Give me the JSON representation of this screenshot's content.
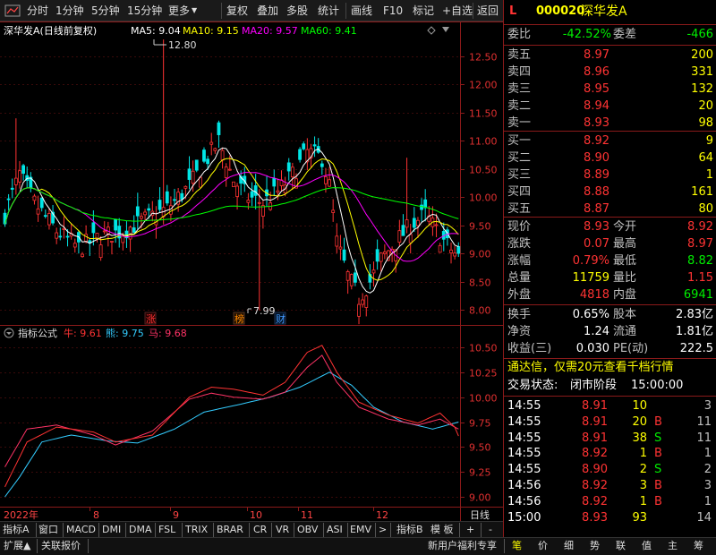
{
  "toolbar": {
    "items": [
      "分时",
      "1分钟",
      "5分钟",
      "15分钟",
      "更多",
      "复权",
      "叠加",
      "多股",
      "统计",
      "画线",
      "F10",
      "标记",
      "+自选",
      "返回"
    ],
    "more_arrow": "▼"
  },
  "chart": {
    "stock_label": "深华发A(日线前复权)",
    "ma": [
      {
        "label": "MA5: 9.04",
        "color": "#ffffff"
      },
      {
        "label": "MA10: 9.15",
        "color": "#ffff00"
      },
      {
        "label": "MA20: 9.57",
        "color": "#ff00ff"
      },
      {
        "label": "MA60: 9.41",
        "color": "#00ff00"
      }
    ],
    "high_label": "12.80",
    "low_label": "7.99",
    "price_ticks": [
      "12.50",
      "12.00",
      "11.50",
      "11.00",
      "10.50",
      "10.00",
      "9.50",
      "9.00",
      "8.50",
      "8.00"
    ],
    "event_markers": [
      {
        "label": "涨",
        "color": "#ff3333"
      },
      {
        "label": "榜",
        "color": "#ff8800"
      },
      {
        "label": "财",
        "color": "#4499ff"
      }
    ],
    "colors": {
      "up": "#ff3333",
      "down": "#00e5e5",
      "ma5": "#ffffff",
      "ma10": "#ffff00",
      "ma20": "#ff00ff",
      "ma60": "#00ff00",
      "grid": "#8b1a1a"
    }
  },
  "indicator": {
    "title": "指标公式",
    "lines": [
      {
        "label": "牛: 9.61",
        "color": "#ff3333"
      },
      {
        "label": "熊: 9.75",
        "color": "#33ccff"
      },
      {
        "label": "马: 9.68",
        "color": "#ff3366"
      }
    ],
    "ticks": [
      "10.50",
      "10.25",
      "10.00",
      "9.75",
      "9.50",
      "9.25",
      "9.00"
    ]
  },
  "date_axis": {
    "labels": [
      "2022年",
      "8",
      "9",
      "10",
      "11",
      "12"
    ],
    "right_label": "日线"
  },
  "bottom_tabs": {
    "tabs": [
      "指标A",
      "窗口",
      "MACD",
      "DMI",
      "DMA",
      "FSL",
      "TRIX",
      "BRAR",
      "CR",
      "VR",
      "OBV",
      "ASI",
      "EMV",
      ">",
      "指标B",
      "模 板",
      "+",
      "-"
    ]
  },
  "status_bar": {
    "left": [
      "扩展▲",
      "关联报价"
    ],
    "promo": "新用户福利专享",
    "tabs": [
      "笔",
      "价",
      "细",
      "势",
      "联",
      "值",
      "主",
      "筹"
    ]
  },
  "quote": {
    "flag": "L",
    "code": "000020",
    "name": "深华发A",
    "webi_label": "委比",
    "webi_value": "-42.52%",
    "weicha_label": "委差",
    "weicha_value": "-466",
    "asks": [
      {
        "label": "卖五",
        "price": "8.97",
        "vol": "200"
      },
      {
        "label": "卖四",
        "price": "8.96",
        "vol": "331"
      },
      {
        "label": "卖三",
        "price": "8.95",
        "vol": "132"
      },
      {
        "label": "卖二",
        "price": "8.94",
        "vol": "20"
      },
      {
        "label": "卖一",
        "price": "8.93",
        "vol": "98"
      }
    ],
    "bids": [
      {
        "label": "买一",
        "price": "8.92",
        "vol": "9"
      },
      {
        "label": "买二",
        "price": "8.90",
        "vol": "64"
      },
      {
        "label": "买三",
        "price": "8.89",
        "vol": "1"
      },
      {
        "label": "买四",
        "price": "8.88",
        "vol": "161"
      },
      {
        "label": "买五",
        "price": "8.87",
        "vol": "80"
      }
    ],
    "stats1": [
      {
        "l1": "现价",
        "v1": "8.93",
        "c1": "red",
        "l2": "今开",
        "v2": "8.92",
        "c2": "red"
      },
      {
        "l1": "涨跌",
        "v1": "0.07",
        "c1": "red",
        "l2": "最高",
        "v2": "8.97",
        "c2": "red"
      },
      {
        "l1": "涨幅",
        "v1": "0.79%",
        "c1": "red",
        "l2": "最低",
        "v2": "8.82",
        "c2": "green"
      },
      {
        "l1": "总量",
        "v1": "11759",
        "c1": "yellow",
        "l2": "量比",
        "v2": "1.15",
        "c2": "red"
      },
      {
        "l1": "外盘",
        "v1": "4818",
        "c1": "red",
        "l2": "内盘",
        "v2": "6941",
        "c2": "green"
      }
    ],
    "stats2": [
      {
        "l1": "换手",
        "v1": "0.65%",
        "l2": "股本",
        "v2": "2.83亿"
      },
      {
        "l1": "净资",
        "v1": "1.24",
        "l2": "流通",
        "v2": "1.81亿"
      },
      {
        "l1": "收益(三)",
        "v1": "0.030",
        "l2": "PE(动)",
        "v2": "222.5"
      }
    ],
    "ad_text": "通达信，仅需20元查看千档行情",
    "status_label": "交易状态:",
    "status_value": "闭市阶段",
    "status_time": "15:00:00",
    "trades": [
      {
        "time": "14:55",
        "price": "8.91",
        "vol": "10",
        "side": "",
        "n": "3"
      },
      {
        "time": "14:55",
        "price": "8.91",
        "vol": "20",
        "side": "B",
        "n": "11"
      },
      {
        "time": "14:55",
        "price": "8.91",
        "vol": "38",
        "side": "S",
        "n": "11"
      },
      {
        "time": "14:55",
        "price": "8.92",
        "vol": "1",
        "side": "B",
        "n": "1"
      },
      {
        "time": "14:55",
        "price": "8.90",
        "vol": "2",
        "side": "S",
        "n": "2"
      },
      {
        "time": "14:56",
        "price": "8.92",
        "vol": "3",
        "side": "B",
        "n": "3"
      },
      {
        "time": "14:56",
        "price": "8.92",
        "vol": "1",
        "side": "B",
        "n": "1"
      },
      {
        "time": "15:00",
        "price": "8.93",
        "vol": "93",
        "side": "",
        "n": "14"
      }
    ]
  }
}
